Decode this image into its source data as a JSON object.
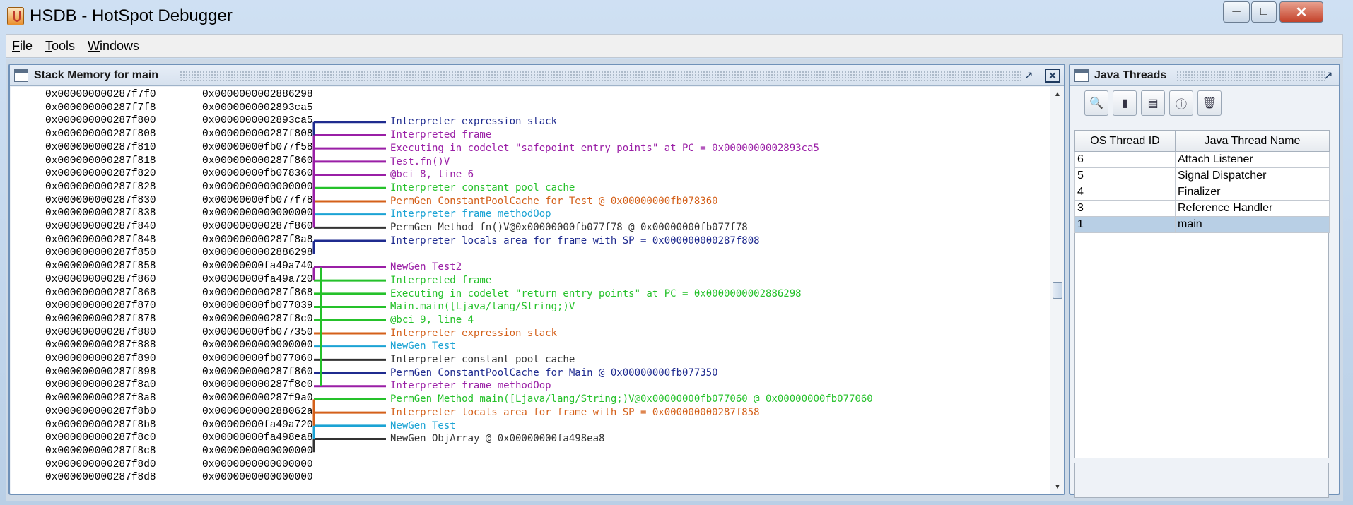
{
  "window": {
    "title": "HSDB - HotSpot Debugger",
    "minimize": "─",
    "maximize": "□",
    "close": "✕"
  },
  "menu": [
    "File",
    "Tools",
    "Windows"
  ],
  "stack_frame": {
    "title": "Stack Memory for main",
    "rows": [
      [
        "0x000000000287f7f0",
        "0x0000000002886298"
      ],
      [
        "0x000000000287f7f8",
        "0x0000000002893ca5"
      ],
      [
        "0x000000000287f800",
        "0x0000000002893ca5"
      ],
      [
        "0x000000000287f808",
        "0x000000000287f808"
      ],
      [
        "0x000000000287f810",
        "0x00000000fb077f58"
      ],
      [
        "0x000000000287f818",
        "0x000000000287f860"
      ],
      [
        "0x000000000287f820",
        "0x00000000fb078360"
      ],
      [
        "0x000000000287f828",
        "0x0000000000000000"
      ],
      [
        "0x000000000287f830",
        "0x00000000fb077f78"
      ],
      [
        "0x000000000287f838",
        "0x0000000000000000"
      ],
      [
        "0x000000000287f840",
        "0x000000000287f860"
      ],
      [
        "0x000000000287f848",
        "0x000000000287f8a8"
      ],
      [
        "0x000000000287f850",
        "0x0000000002886298"
      ],
      [
        "0x000000000287f858",
        "0x00000000fa49a740"
      ],
      [
        "0x000000000287f860",
        "0x00000000fa49a720"
      ],
      [
        "0x000000000287f868",
        "0x000000000287f868"
      ],
      [
        "0x000000000287f870",
        "0x00000000fb077039"
      ],
      [
        "0x000000000287f878",
        "0x000000000287f8c0"
      ],
      [
        "0x000000000287f880",
        "0x00000000fb077350"
      ],
      [
        "0x000000000287f888",
        "0x0000000000000000"
      ],
      [
        "0x000000000287f890",
        "0x00000000fb077060"
      ],
      [
        "0x000000000287f898",
        "0x000000000287f860"
      ],
      [
        "0x000000000287f8a0",
        "0x000000000287f8c0"
      ],
      [
        "0x000000000287f8a8",
        "0x000000000287f9a0"
      ],
      [
        "0x000000000287f8b0",
        "0x000000000288062a"
      ],
      [
        "0x000000000287f8b8",
        "0x00000000fa49a720"
      ],
      [
        "0x000000000287f8c0",
        "0x00000000fa498ea8"
      ],
      [
        "0x000000000287f8c8",
        "0x0000000000000000"
      ],
      [
        "0x000000000287f8d0",
        "0x0000000000000000"
      ],
      [
        "0x000000000287f8d8",
        "0x0000000000000000"
      ]
    ],
    "annotations": [
      {
        "row": 2,
        "text": "Interpreter expression stack",
        "color": "#1f2b8f"
      },
      {
        "row": 3,
        "text": "Interpreted frame",
        "color": "#9a1fa6"
      },
      {
        "row": 4,
        "text": "Executing in codelet \"safepoint entry points\" at PC = 0x0000000002893ca5",
        "color": "#9a1fa6"
      },
      {
        "row": 5,
        "text": "Test.fn()V",
        "color": "#9a1fa6"
      },
      {
        "row": 6,
        "text": "@bci 8, line 6",
        "color": "#9a1fa6"
      },
      {
        "row": 7,
        "text": "Interpreter constant pool cache",
        "color": "#25c12a"
      },
      {
        "row": 8,
        "text": "PermGen ConstantPoolCache for Test @ 0x00000000fb078360",
        "color": "#d4601a"
      },
      {
        "row": 9,
        "text": "Interpreter frame methodOop",
        "color": "#1ba3d4"
      },
      {
        "row": 10,
        "text": "PermGen Method fn()V@0x00000000fb077f78 @ 0x00000000fb077f78",
        "color": "#333333"
      },
      {
        "row": 11,
        "text": "Interpreter locals area for frame with SP = 0x000000000287f808",
        "color": "#1f2b8f"
      },
      {
        "row": 13,
        "text": "NewGen Test2",
        "color": "#9a1fa6"
      },
      {
        "row": 14,
        "text": "Interpreted frame",
        "color": "#25c12a"
      },
      {
        "row": 15,
        "text": "Executing in codelet \"return entry points\" at PC = 0x0000000002886298",
        "color": "#25c12a"
      },
      {
        "row": 16,
        "text": "Main.main([Ljava/lang/String;)V",
        "color": "#25c12a"
      },
      {
        "row": 17,
        "text": "@bci 9, line 4",
        "color": "#25c12a"
      },
      {
        "row": 18,
        "text": "Interpreter expression stack",
        "color": "#d4601a"
      },
      {
        "row": 19,
        "text": "NewGen Test",
        "color": "#1ba3d4"
      },
      {
        "row": 20,
        "text": "Interpreter constant pool cache",
        "color": "#333333"
      },
      {
        "row": 21,
        "text": "PermGen ConstantPoolCache for Main @ 0x00000000fb077350",
        "color": "#1f2b8f"
      },
      {
        "row": 22,
        "text": "Interpreter frame methodOop",
        "color": "#9a1fa6"
      },
      {
        "row": 23,
        "text": "PermGen Method main([Ljava/lang/String;)V@0x00000000fb077060 @ 0x00000000fb077060",
        "color": "#25c12a"
      },
      {
        "row": 24,
        "text": "Interpreter locals area for frame with SP = 0x000000000287f858",
        "color": "#d4601a"
      },
      {
        "row": 25,
        "text": "NewGen Test",
        "color": "#1ba3d4"
      },
      {
        "row": 26,
        "text": "NewGen ObjArray @ 0x00000000fa498ea8",
        "color": "#333333"
      }
    ]
  },
  "threads_frame": {
    "title": "Java Threads",
    "toolbar_icons": [
      "inspect-thread-icon",
      "stack-memory-icon",
      "show-java-stack-icon",
      "thread-info-icon",
      "delete-icon"
    ],
    "columns": [
      "OS Thread ID",
      "Java Thread Name"
    ],
    "rows": [
      {
        "id": "6",
        "name": "Attach Listener"
      },
      {
        "id": "5",
        "name": "Signal Dispatcher"
      },
      {
        "id": "4",
        "name": "Finalizer"
      },
      {
        "id": "3",
        "name": "Reference Handler"
      },
      {
        "id": "1",
        "name": "main"
      }
    ],
    "selected_row": 4
  }
}
